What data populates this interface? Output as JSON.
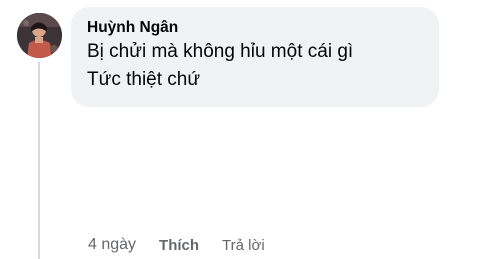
{
  "comment": {
    "author": "Huỳnh Ngân",
    "lines": [
      "Bị chửi mà không hỉu một cái gì",
      "Tức thiệt chứ"
    ],
    "time": "4 ngày",
    "like_label": "Thích",
    "reply_label": "Trả lời"
  },
  "avatar": {
    "icon": "profile-photo"
  }
}
